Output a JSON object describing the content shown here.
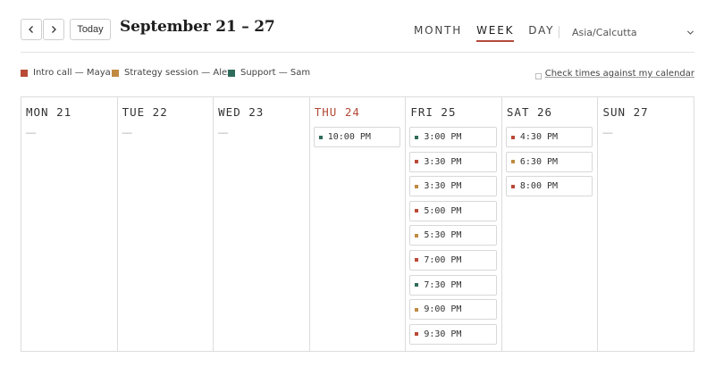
{
  "header": {
    "today_label": "Today",
    "range_title": "September 21 – 27",
    "views": [
      {
        "label": "MONTH",
        "active": false
      },
      {
        "label": "WEEK",
        "active": true
      },
      {
        "label": "DAY",
        "active": false
      }
    ],
    "timezone": "Asia/Calcutta",
    "icons": {
      "prev": "chevron-left-icon",
      "next": "chevron-right-icon",
      "timezone_dropdown": "chevron-down-icon"
    }
  },
  "legend": {
    "items": [
      {
        "label": "Intro call — Maya",
        "color": "#b84a36"
      },
      {
        "label": "Strategy session — Alex",
        "color": "#c08a42"
      },
      {
        "label": "Support — Sam",
        "color": "#2f6b5a"
      }
    ],
    "check_label": "Check times against my calendar"
  },
  "accent": "#b34a3a",
  "days": [
    {
      "label": "MON 21",
      "is_today": false,
      "empty_label": "—",
      "slots": []
    },
    {
      "label": "TUE 22",
      "is_today": false,
      "empty_label": "—",
      "slots": []
    },
    {
      "label": "WED 23",
      "is_today": false,
      "empty_label": "—",
      "slots": []
    },
    {
      "label": "THU 24",
      "is_today": true,
      "empty_label": "",
      "slots": [
        {
          "time": "10:00 PM",
          "type": 2
        }
      ]
    },
    {
      "label": "FRI 25",
      "is_today": false,
      "empty_label": "",
      "slots": [
        {
          "time": "3:00 PM",
          "type": 2
        },
        {
          "time": "3:30 PM",
          "type": 0
        },
        {
          "time": "3:30 PM",
          "type": 1
        },
        {
          "time": "5:00 PM",
          "type": 0
        },
        {
          "time": "5:30 PM",
          "type": 1
        },
        {
          "time": "7:00 PM",
          "type": 0
        },
        {
          "time": "7:30 PM",
          "type": 2
        },
        {
          "time": "9:00 PM",
          "type": 1
        },
        {
          "time": "9:30 PM",
          "type": 0
        }
      ]
    },
    {
      "label": "SAT 26",
      "is_today": false,
      "empty_label": "",
      "slots": [
        {
          "time": "4:30 PM",
          "type": 0
        },
        {
          "time": "6:30 PM",
          "type": 1
        },
        {
          "time": "8:00 PM",
          "type": 0
        }
      ]
    },
    {
      "label": "SUN 27",
      "is_today": false,
      "empty_label": "—",
      "slots": []
    }
  ]
}
